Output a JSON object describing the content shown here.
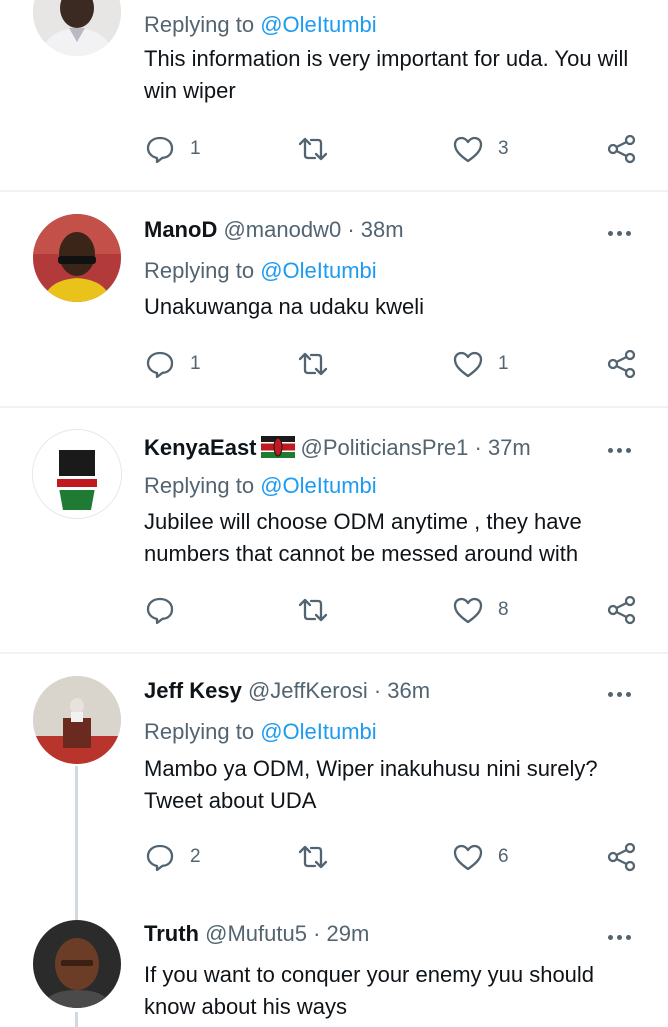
{
  "tweets": [
    {
      "name": "",
      "handle": "",
      "time": "",
      "replying_prefix": "Replying to",
      "replying_to": "@OleItumbi",
      "text": "This information is very important for uda. You will win wiper",
      "reply_count": "1",
      "retweet_count": "",
      "like_count": "3"
    },
    {
      "name": "ManoD",
      "handle": "@manodw0",
      "time": "· 38m",
      "replying_prefix": "Replying to",
      "replying_to": "@OleItumbi",
      "text": "Unakuwanga na udaku kweli",
      "reply_count": "1",
      "retweet_count": "",
      "like_count": "1"
    },
    {
      "name": "KenyaEast",
      "handle": "@PoliticiansPre1",
      "time": "· 37m",
      "replying_prefix": "Replying to",
      "replying_to": "@OleItumbi",
      "text": "Jubilee will choose ODM anytime , they have numbers that cannot be messed around with",
      "reply_count": "",
      "retweet_count": "",
      "like_count": "8"
    },
    {
      "name": "Jeff Kesy",
      "handle": "@JeffKerosi",
      "time": "· 36m",
      "replying_prefix": "Replying to",
      "replying_to": "@OleItumbi",
      "text": "Mambo ya ODM, Wiper inakuhusu nini surely? Tweet about UDA",
      "reply_count": "2",
      "retweet_count": "",
      "like_count": "6"
    },
    {
      "name": "Truth",
      "handle": "@Mufutu5",
      "time": "· 29m",
      "text": "If you want to conquer your enemy yuu should know about his ways"
    }
  ],
  "colors": {
    "accent": "#1d9bf0",
    "secondary_text": "#536471",
    "divider": "#eff3f4"
  },
  "icons": [
    "reply-icon",
    "retweet-icon",
    "like-icon",
    "share-icon",
    "more-icon",
    "kenya-flag-icon"
  ]
}
